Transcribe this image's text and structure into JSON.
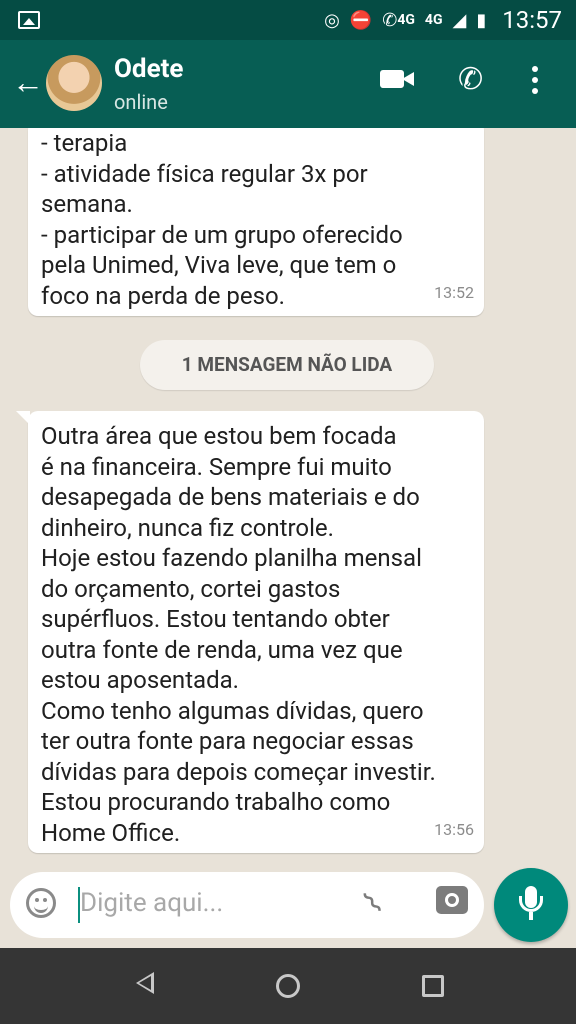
{
  "status_bar": {
    "time": "13:57",
    "network_labels": [
      "4G",
      "4G"
    ]
  },
  "header": {
    "contact_name": "Odete",
    "status": "online"
  },
  "messages": [
    {
      "text": "- terapia\n- atividade física regular 3x por\nsemana.\n- participar de um grupo oferecido\npela Unimed, Viva leve, que tem o\nfoco na perda de peso.",
      "time": "13:52"
    },
    {
      "text": "Outra área que estou bem focada\né na financeira. Sempre fui muito\ndesapegada de bens materiais e do\ndinheiro, nunca fiz controle.\nHoje estou fazendo planilha mensal\ndo orçamento, cortei gastos\nsupérfluos. Estou tentando obter\noutra fonte de renda, uma vez que\nestou aposentada.\nComo tenho algumas dívidas, quero\nter outra fonte para negociar essas\ndívidas para depois começar investir.\nEstou procurando trabalho como\nHome Office.",
      "time": "13:56"
    }
  ],
  "unread_banner": "1 MENSAGEM NÃO LIDA",
  "input": {
    "placeholder": "Digite aqui..."
  },
  "colors": {
    "header": "#075e54",
    "status_bar": "#054c44",
    "accent": "#00897b",
    "chat_bg": "#e8e2d8"
  }
}
